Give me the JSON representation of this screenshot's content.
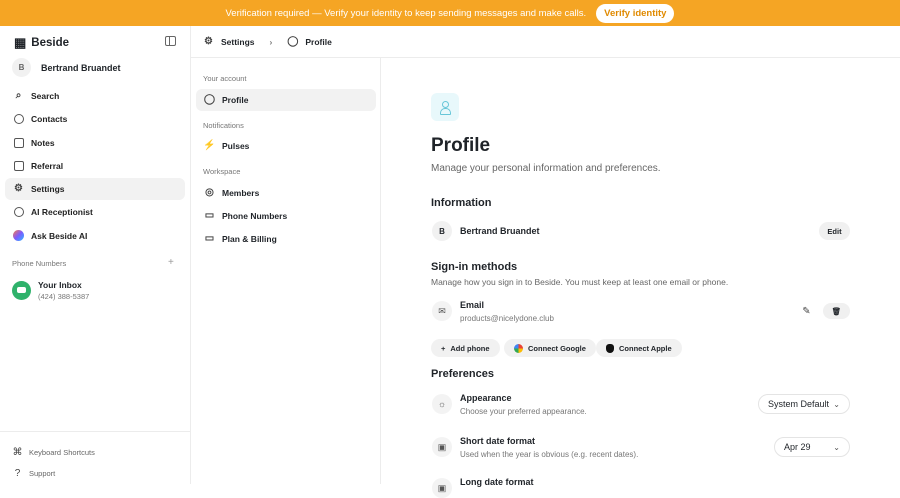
{
  "banner": {
    "message": "Verification required — Verify your identity to keep sending messages and make calls.",
    "button": "Verify identity"
  },
  "brand": {
    "name": "Beside"
  },
  "user": {
    "initial": "B",
    "name": "Bertrand Bruandet"
  },
  "sidebar": {
    "items": [
      {
        "label": "Search",
        "icon": "search-icon"
      },
      {
        "label": "Contacts",
        "icon": "contacts-icon"
      },
      {
        "label": "Notes",
        "icon": "notes-icon"
      },
      {
        "label": "Referral",
        "icon": "referral-icon"
      },
      {
        "label": "Settings",
        "icon": "gear-icon"
      },
      {
        "label": "AI Receptionist",
        "icon": "receptionist-icon"
      },
      {
        "label": "Ask Beside AI",
        "icon": "ai-icon"
      }
    ],
    "phone_label": "Phone Numbers",
    "inbox": {
      "name": "Your Inbox",
      "number": "(424) 388-5387"
    },
    "footer": [
      {
        "label": "Keyboard Shortcuts"
      },
      {
        "label": "Support"
      }
    ]
  },
  "topbar": {
    "settings": "Settings",
    "profile": "Profile"
  },
  "settings_nav": {
    "sections": [
      "Your account",
      "Notifications",
      "Workspace"
    ],
    "items": [
      "Profile",
      "Pulses",
      "Members",
      "Phone Numbers",
      "Plan & Billing"
    ]
  },
  "content": {
    "title": "Profile",
    "subtitle": "Manage your personal information and preferences.",
    "information": "Information",
    "avatar_initial": "B",
    "name": "Bertrand Bruandet",
    "edit": "Edit",
    "signin": "Sign-in methods",
    "signin_desc": "Manage how you sign in to Beside. You must keep at least one email or phone.",
    "email_title": "Email",
    "email_value": "products@nicelydone.club",
    "buttons": [
      "Add phone",
      "Connect Google",
      "Connect Apple"
    ],
    "preferences": "Preferences",
    "appearance_title": "Appearance",
    "appearance_desc": "Choose your preferred appearance.",
    "appearance_value": "System Default",
    "short_title": "Short date format",
    "short_desc": "Used when the year is obvious (e.g. recent dates).",
    "short_value": "Apr 29",
    "long_title": "Long date format"
  },
  "colors": {
    "banner": "#f5a524",
    "accent": "#67c6d8",
    "inbox": "#2fb26b"
  }
}
